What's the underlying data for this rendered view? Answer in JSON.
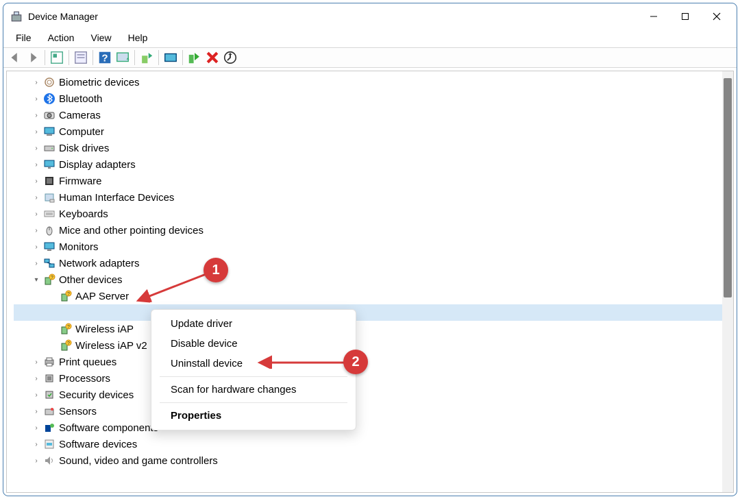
{
  "window": {
    "title": "Device Manager"
  },
  "menu": {
    "items": [
      "File",
      "Action",
      "View",
      "Help"
    ]
  },
  "tree": {
    "categories": [
      {
        "label": "Biometric devices",
        "iconName": "biometric-icon",
        "expanded": false
      },
      {
        "label": "Bluetooth",
        "iconName": "bluetooth-icon",
        "expanded": false
      },
      {
        "label": "Cameras",
        "iconName": "camera-icon",
        "expanded": false
      },
      {
        "label": "Computer",
        "iconName": "computer-icon",
        "expanded": false
      },
      {
        "label": "Disk drives",
        "iconName": "disk-icon",
        "expanded": false
      },
      {
        "label": "Display adapters",
        "iconName": "display-icon",
        "expanded": false
      },
      {
        "label": "Firmware",
        "iconName": "firmware-icon",
        "expanded": false
      },
      {
        "label": "Human Interface Devices",
        "iconName": "hid-icon",
        "expanded": false
      },
      {
        "label": "Keyboards",
        "iconName": "keyboard-icon",
        "expanded": false
      },
      {
        "label": "Mice and other pointing devices",
        "iconName": "mouse-icon",
        "expanded": false
      },
      {
        "label": "Monitors",
        "iconName": "monitor-icon",
        "expanded": false
      },
      {
        "label": "Network adapters",
        "iconName": "network-icon",
        "expanded": false
      },
      {
        "label": "Other devices",
        "iconName": "other-icon",
        "expanded": true,
        "children": [
          {
            "label": "AAP Server",
            "iconName": "unknown-device-icon",
            "selected": false
          },
          {
            "label": "",
            "iconName": "blank-icon",
            "selected": true
          },
          {
            "label": "Wireless iAP",
            "iconName": "unknown-device-icon",
            "selected": false
          },
          {
            "label": "Wireless iAP v2",
            "iconName": "unknown-device-icon",
            "selected": false
          }
        ]
      },
      {
        "label": "Print queues",
        "iconName": "printer-icon",
        "expanded": false
      },
      {
        "label": "Processors",
        "iconName": "cpu-icon",
        "expanded": false
      },
      {
        "label": "Security devices",
        "iconName": "security-icon",
        "expanded": false
      },
      {
        "label": "Sensors",
        "iconName": "sensor-icon",
        "expanded": false
      },
      {
        "label": "Software components",
        "iconName": "sw-component-icon",
        "expanded": false
      },
      {
        "label": "Software devices",
        "iconName": "sw-device-icon",
        "expanded": false
      },
      {
        "label": "Sound, video and game controllers",
        "iconName": "sound-icon",
        "expanded": false
      }
    ]
  },
  "contextMenu": {
    "items": [
      {
        "label": "Update driver",
        "bold": false
      },
      {
        "label": "Disable device",
        "bold": false
      },
      {
        "label": "Uninstall device",
        "bold": false
      },
      {
        "sep": true
      },
      {
        "label": "Scan for hardware changes",
        "bold": false
      },
      {
        "sep": true
      },
      {
        "label": "Properties",
        "bold": true
      }
    ]
  },
  "annotations": {
    "markers": [
      {
        "num": "1"
      },
      {
        "num": "2"
      }
    ]
  }
}
